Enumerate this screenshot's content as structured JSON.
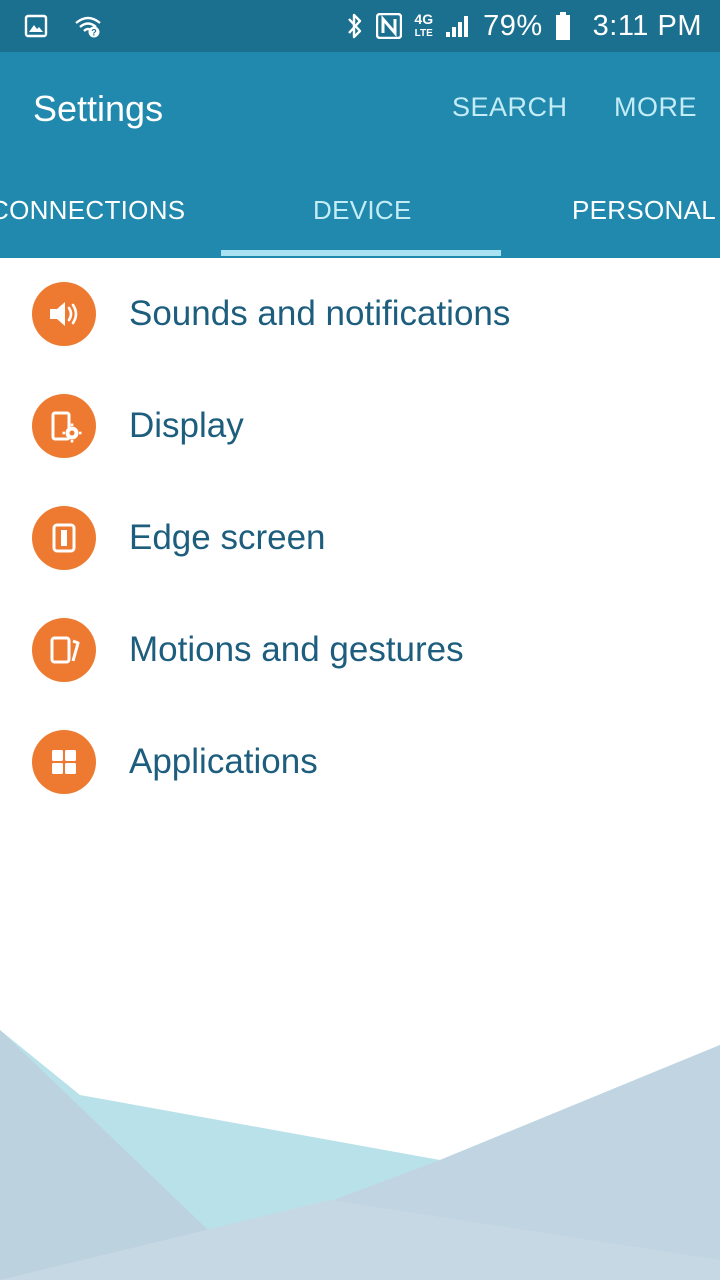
{
  "status_bar": {
    "network_type": "4G",
    "network_sub": "LTE",
    "battery": "79%",
    "time": "3:11 PM"
  },
  "app_bar": {
    "title": "Settings",
    "actions": {
      "search": "SEARCH",
      "more": "MORE"
    }
  },
  "tabs": [
    {
      "label": "CONNECTIONS",
      "selected": false
    },
    {
      "label": "DEVICE",
      "selected": true
    },
    {
      "label": "PERSONAL",
      "selected": false
    }
  ],
  "settings": [
    {
      "label": "Sounds and notifications",
      "icon": "speaker-icon"
    },
    {
      "label": "Display",
      "icon": "display-settings-icon"
    },
    {
      "label": "Edge screen",
      "icon": "edge-screen-icon"
    },
    {
      "label": "Motions and gestures",
      "icon": "motion-icon"
    },
    {
      "label": "Applications",
      "icon": "apps-grid-icon"
    }
  ],
  "colors": {
    "status_bar": "#1b6f8f",
    "app_bar": "#2089ad",
    "accent_icon": "#ee7a32",
    "list_text": "#1d5e7e",
    "tab_indicator": "#a9e2f2"
  }
}
